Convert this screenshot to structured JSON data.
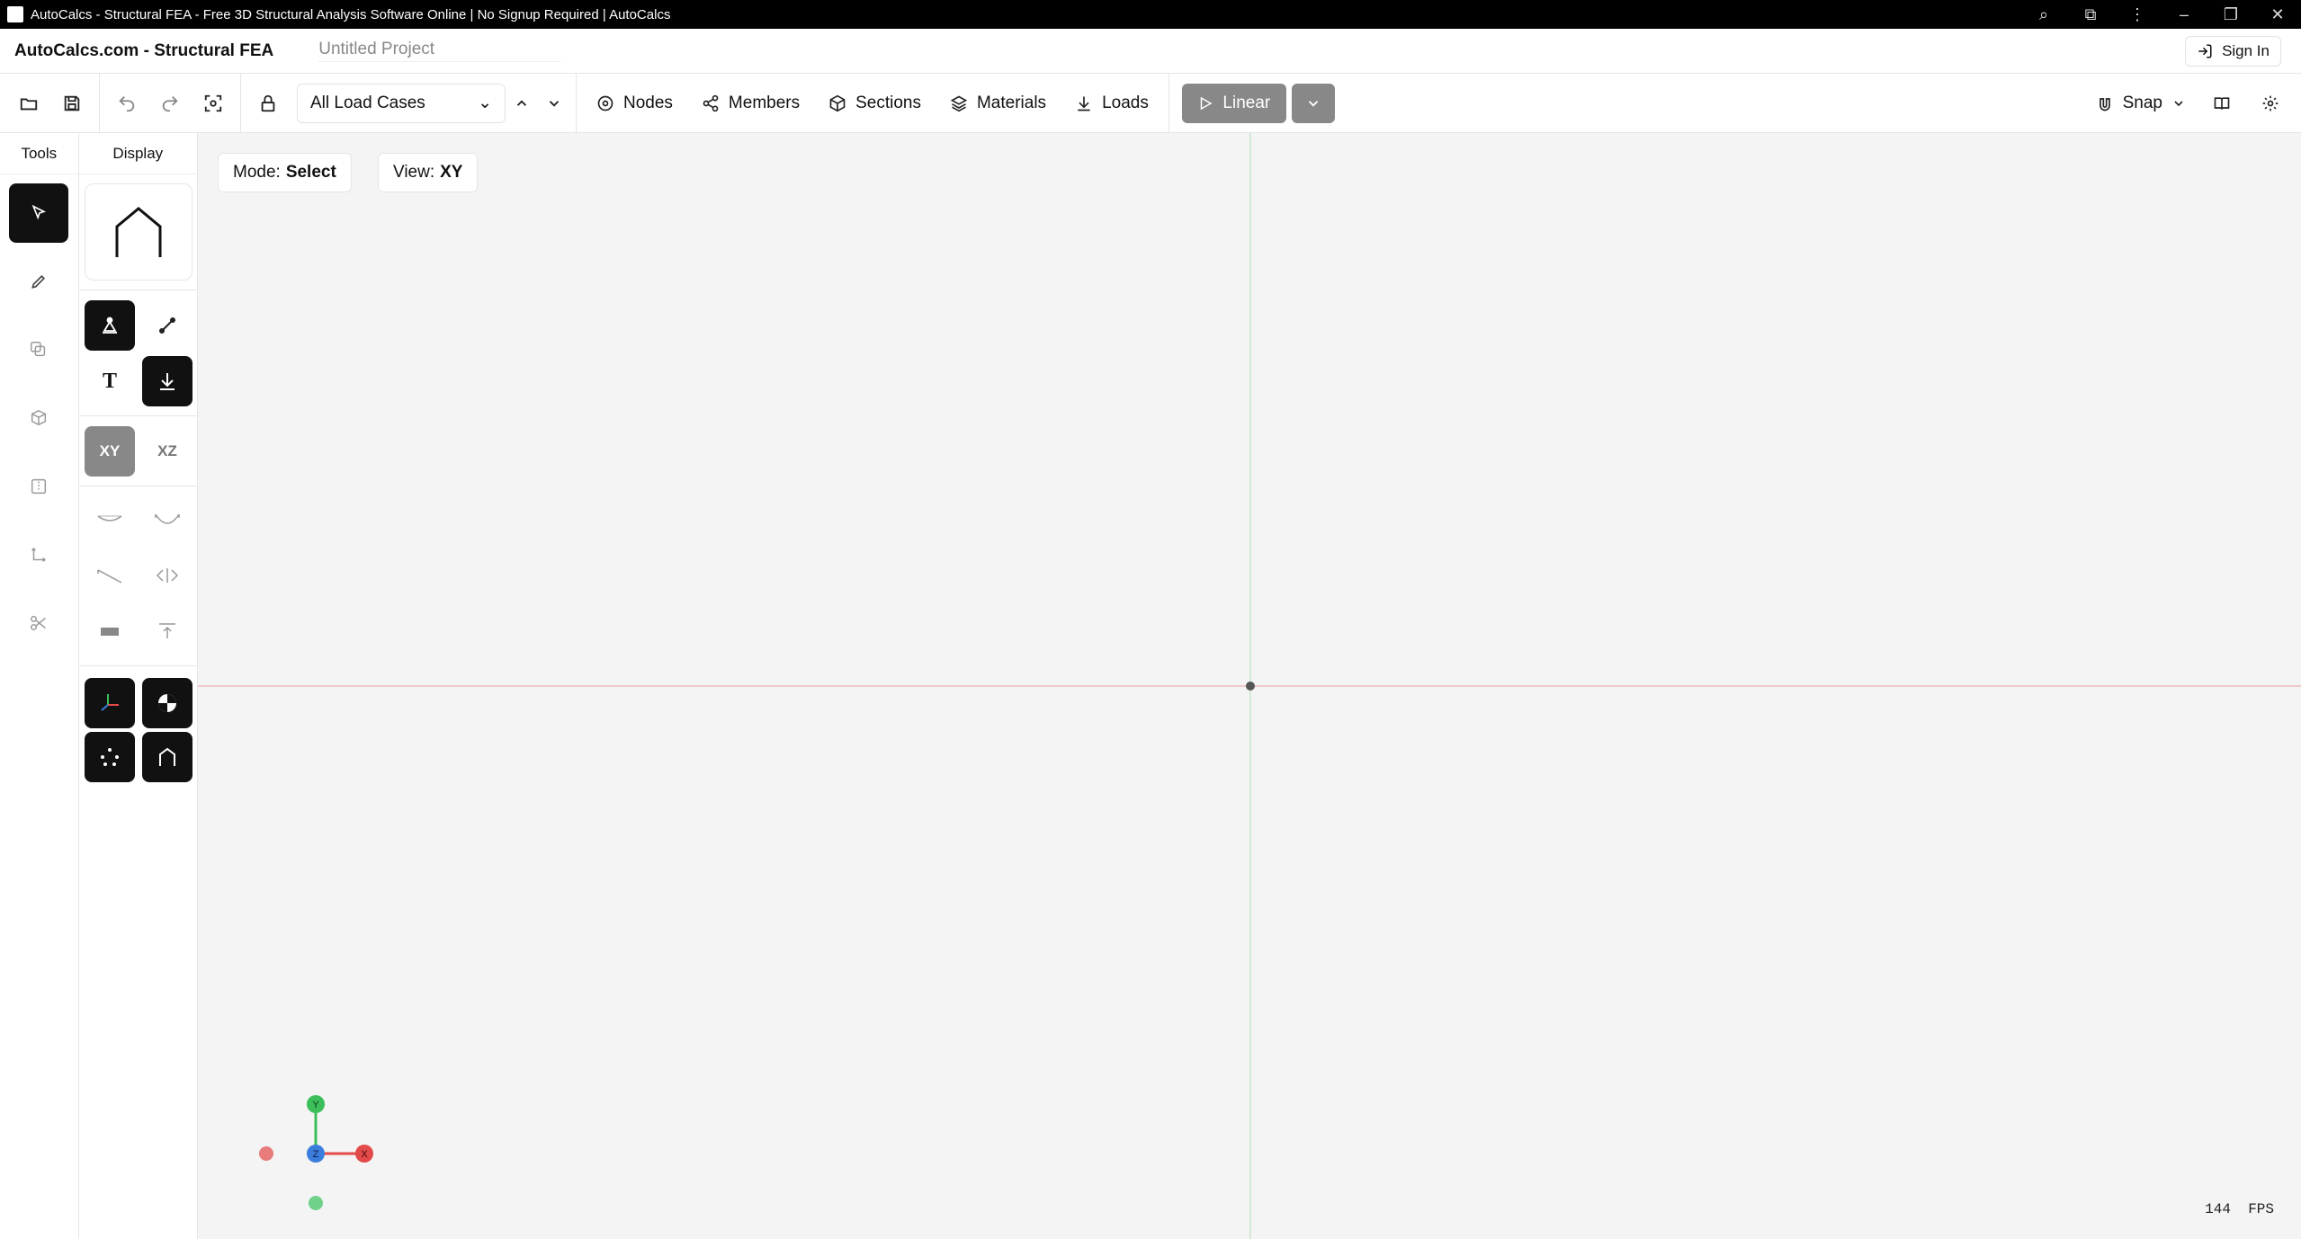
{
  "window": {
    "title": "AutoCalcs - Structural FEA - Free 3D Structural Analysis Software Online | No Signup Required | AutoCalcs"
  },
  "app": {
    "brand": "AutoCalcs.com - Structural FEA",
    "project_name": "Untitled Project",
    "sign_in": "Sign In"
  },
  "toolbar": {
    "load_case": "All Load Cases",
    "nodes": "Nodes",
    "members": "Members",
    "sections": "Sections",
    "materials": "Materials",
    "loads": "Loads",
    "run": "Linear",
    "snap": "Snap"
  },
  "sidebar": {
    "tab_tools": "Tools",
    "tab_display": "Display",
    "text_toggle": "T",
    "view_xy": "XY",
    "view_xz": "XZ"
  },
  "canvas": {
    "mode_label": "Mode:",
    "mode_value": "Select",
    "view_label": "View:",
    "view_value": "XY",
    "fps_value": "144",
    "fps_unit": "FPS",
    "axis_x": "X",
    "axis_y": "Y",
    "axis_z": "Z"
  },
  "colors": {
    "axis_x": "#e24a4a",
    "axis_y": "#3cbf5a",
    "axis_z": "#3b7ddd",
    "accent": "#111111"
  }
}
